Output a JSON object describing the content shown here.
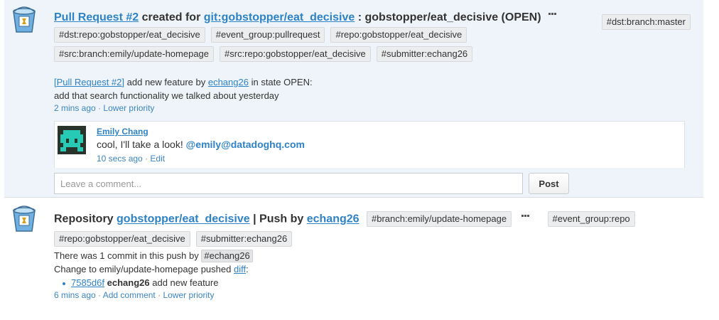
{
  "event1": {
    "title_link": "Pull Request #2",
    "title_mid": "created for",
    "repo_link": "git:gobstopper/eat_decisive",
    "title_tail": ": gobstopper/eat_decisive (OPEN)",
    "tag_right": "#dst:branch:master",
    "tags": [
      "#dst:repo:gobstopper/eat_decisive",
      "#event_group:pullrequest",
      "#repo:gobstopper/eat_decisive",
      "#src:branch:emily/update-homepage",
      "#src:repo:gobstopper/eat_decisive",
      "#submitter:echang26"
    ],
    "body_link": "[Pull Request #2]",
    "body_mid": "add new feature by",
    "body_user": "echang26",
    "body_tail": "in state OPEN:",
    "body_line2": "add that search functionality we talked about yesterday",
    "meta_time": "2 mins ago",
    "meta_sep": "·",
    "meta_priority": "Lower priority",
    "comment": {
      "author": "Emily Chang",
      "text": "cool, I'll take a look!",
      "mention": "@emily@datadoghq.com",
      "time": "10 secs ago",
      "sep": "·",
      "edit": "Edit"
    },
    "input_placeholder": "Leave a comment...",
    "post_label": "Post"
  },
  "event2": {
    "title_prefix": "Repository",
    "repo_link": "gobstopper/eat_decisive",
    "title_mid": "| Push by",
    "user_link": "echang26",
    "tags_inline": [
      "#branch:emily/update-homepage"
    ],
    "tag_after_dots": "#event_group:repo",
    "tags": [
      "#repo:gobstopper/eat_decisive",
      "#submitter:echang26"
    ],
    "line1_prefix": "There was 1 commit in this push by",
    "line1_tag": "#echang26",
    "line2_prefix": "Change to emily/update-homepage pushed",
    "line2_link": "diff",
    "line2_suffix": ":",
    "commit_hash": "7585d6f",
    "commit_author": "echang26",
    "commit_msg": "add new feature",
    "meta_time": "6 mins ago",
    "meta_sep": "·",
    "meta_add_comment": "Add comment",
    "meta_priority": "Lower priority"
  },
  "colors": {
    "link": "#2e82c6",
    "event_bg": "#eef4f9",
    "tag_bg": "#ecedee"
  },
  "icons": {
    "source_icon": "bucket-icon",
    "more_icon": "more-dots-icon"
  }
}
